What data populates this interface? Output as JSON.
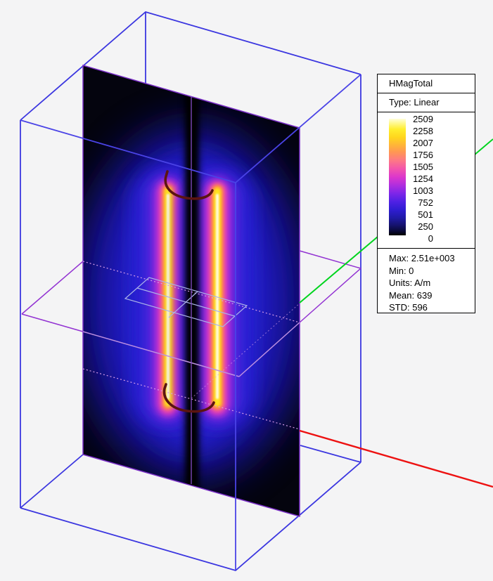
{
  "legend": {
    "title": "HMagTotal",
    "type_label": "Type: Linear",
    "scale": [
      "2509",
      "2258",
      "2007",
      "1756",
      "1505",
      "1254",
      "1003",
      "752",
      "501",
      "250",
      "0"
    ],
    "stats": [
      "Max: 2.51e+003",
      "Min: 0",
      "Units: A/m",
      "Mean: 639",
      "STD: 596"
    ]
  },
  "colors": {
    "background": "#f4f4f5",
    "bounding_box_wireframe": "#3b36e0",
    "field_plane_outline": "#7b2fc8",
    "mid_plane_wireframe": "#9232d2",
    "mid_plane_over_field": "#bd8fe0",
    "hidden_edge_dotted": "#d49ae8",
    "inner_sheet_wireframe": "#aab2e8",
    "coil_wire": "#5c1410",
    "center_axis_line": "#8850cc",
    "axis_y_green": "#00d41e",
    "axis_x_red": "#ed1111"
  },
  "chart_data": {
    "type": "heatmap",
    "title": "HMagTotal",
    "scale_type": "Linear",
    "colorbar_tick_values": [
      2509,
      2258,
      2007,
      1756,
      1505,
      1254,
      1003,
      752,
      501,
      250,
      0
    ],
    "value_range": [
      0,
      2509
    ],
    "units": "A/m",
    "stats": {
      "max": "2.51e+003",
      "min": 0,
      "units": "A/m",
      "mean": 639,
      "std": 596
    },
    "colormap": [
      "#000000",
      "#14124e",
      "#2a1fd0",
      "#6e24e6",
      "#a02be2",
      "#d232d2",
      "#ee46b6",
      "#fb6b8e",
      "#ff8a62",
      "#ffa83c",
      "#ffd21c",
      "#ffef29",
      "#ffffd9"
    ],
    "legend_position": "top-right",
    "description": "H-field magnitude on a vertical cut plane through a coil inside a wireframe box: two bright vertical high-field bands along the coil conductors, dark null band on the axis, dark coil turn arcs at top and bottom, green Y axis and red X axis emerging from the plane."
  }
}
